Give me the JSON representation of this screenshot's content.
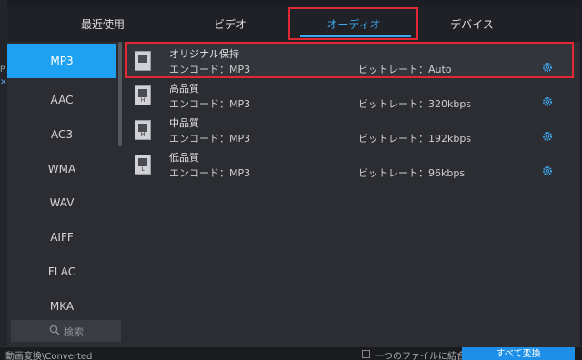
{
  "tabs": [
    {
      "label": "最近使用"
    },
    {
      "label": "ビデオ"
    },
    {
      "label": "オーディオ"
    },
    {
      "label": "デバイス"
    }
  ],
  "formats": [
    {
      "label": "MP3"
    },
    {
      "label": "AAC"
    },
    {
      "label": "AC3"
    },
    {
      "label": "WMA"
    },
    {
      "label": "WAV"
    },
    {
      "label": "AIFF"
    },
    {
      "label": "FLAC"
    },
    {
      "label": "MKA"
    }
  ],
  "search": {
    "placeholder": "検索"
  },
  "presets": [
    {
      "name": "オリジナル保持",
      "encode": "エンコード：MP3",
      "bitrate": "ビットレート：Auto",
      "icon_letter": ""
    },
    {
      "name": "高品質",
      "encode": "エンコード：MP3",
      "bitrate": "ビットレート：320kbps",
      "icon_letter": "H"
    },
    {
      "name": "中品質",
      "encode": "エンコード：MP3",
      "bitrate": "ビットレート：192kbps",
      "icon_letter": "M"
    },
    {
      "name": "低品質",
      "encode": "エンコード：MP3",
      "bitrate": "ビットレート：96kbps",
      "icon_letter": "L"
    }
  ],
  "background": {
    "status_text": "動画変換\\Converted",
    "merge_label": "一つのファイルに結合",
    "convert_all_button": "すべて変換",
    "left_fragment": "P"
  },
  "colors": {
    "accent": "#1ea1f1",
    "highlight": "#e02a33"
  }
}
